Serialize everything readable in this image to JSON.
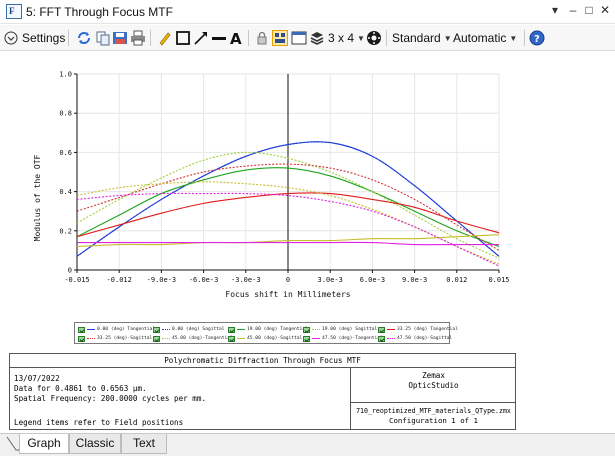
{
  "window": {
    "title": "5: FFT Through Focus MTF",
    "icon_name": "zemax-f-icon",
    "controls": [
      "chevron-down-icon",
      "minimize-icon",
      "maximize-icon",
      "close-icon"
    ]
  },
  "toolbar": {
    "settings_label": "Settings",
    "grid_label": "3 x 4",
    "standard_label": "Standard",
    "automatic_label": "Automatic",
    "icons": [
      "refresh-icon",
      "copy-icon",
      "save-icon",
      "print-icon",
      "pencil-icon",
      "rectangle-icon",
      "line-arrow-icon",
      "line-icon",
      "text-icon",
      "lock-icon",
      "layout-icon",
      "window-icon",
      "layers-icon",
      "settings-circle-icon",
      "help-icon"
    ]
  },
  "chart_data": {
    "type": "line",
    "xlabel": "Focus shift in Millimeters",
    "ylabel": "Modulus of the OTF",
    "xlim": [
      -0.015,
      0.015
    ],
    "ylim": [
      0,
      1.0
    ],
    "x_ticks": [
      "-0.015",
      "-0.012",
      "-9.0e-3",
      "-6.0e-3",
      "-3.0e-3",
      "0",
      "3.0e-3",
      "6.0e-3",
      "9.0e-3",
      "0.012",
      "0.015"
    ],
    "y_ticks": [
      "0",
      "0.2",
      "0.4",
      "0.6",
      "0.8",
      "1.0"
    ],
    "grid": true,
    "x": [
      -0.015,
      -0.012,
      -0.009,
      -0.006,
      -0.003,
      0,
      0.003,
      0.006,
      0.009,
      0.012,
      0.015
    ],
    "series": [
      {
        "name": "0.00 (deg) Tangential",
        "color": "#1f3fd6",
        "dash": false,
        "values": [
          0.07,
          0.22,
          0.36,
          0.48,
          0.58,
          0.64,
          0.65,
          0.58,
          0.43,
          0.25,
          0.07
        ]
      },
      {
        "name": "0.00 (deg) Sagittal",
        "color": "#1f3fd6",
        "dash": true,
        "values": [
          0.07,
          0.22,
          0.36,
          0.48,
          0.58,
          0.64,
          0.65,
          0.58,
          0.43,
          0.25,
          0.07
        ]
      },
      {
        "name": "19.00 (deg) Tangential",
        "color": "#1ea41e",
        "dash": false,
        "values": [
          0.17,
          0.28,
          0.39,
          0.46,
          0.51,
          0.52,
          0.48,
          0.4,
          0.3,
          0.2,
          0.12
        ]
      },
      {
        "name": "19.00 (deg) Sagittal",
        "color": "#9fd13a",
        "dash": true,
        "values": [
          0.24,
          0.36,
          0.47,
          0.56,
          0.6,
          0.57,
          0.5,
          0.4,
          0.28,
          0.16,
          0.06
        ]
      },
      {
        "name": "33.25 (deg) Tangential",
        "color": "#e01b1b",
        "dash": false,
        "values": [
          0.17,
          0.23,
          0.29,
          0.34,
          0.37,
          0.39,
          0.39,
          0.36,
          0.32,
          0.25,
          0.19
        ]
      },
      {
        "name": "33.25 (deg) Sagittal",
        "color": "#d43333",
        "dash": true,
        "values": [
          0.3,
          0.37,
          0.44,
          0.5,
          0.53,
          0.54,
          0.52,
          0.46,
          0.36,
          0.23,
          0.1
        ]
      },
      {
        "name": "45.00 (deg) Tangential",
        "color": "#c8bd2a",
        "dash": true,
        "values": [
          0.38,
          0.42,
          0.44,
          0.45,
          0.44,
          0.42,
          0.38,
          0.31,
          0.22,
          0.12,
          0.03
        ]
      },
      {
        "name": "45.00 (deg) Sagittal",
        "color": "#c8bd2a",
        "dash": false,
        "values": [
          0.12,
          0.13,
          0.13,
          0.14,
          0.14,
          0.15,
          0.15,
          0.16,
          0.16,
          0.17,
          0.18
        ]
      },
      {
        "name": "47.50 (deg) Tangential",
        "color": "#e223e2",
        "dash": false,
        "values": [
          0.14,
          0.14,
          0.14,
          0.14,
          0.14,
          0.14,
          0.14,
          0.14,
          0.13,
          0.13,
          0.13
        ]
      },
      {
        "name": "47.50 (deg) Sagittal",
        "color": "#e223e2",
        "dash": true,
        "values": [
          0.36,
          0.38,
          0.39,
          0.39,
          0.39,
          0.38,
          0.35,
          0.3,
          0.22,
          0.12,
          0.02
        ]
      }
    ],
    "legend_placement": "bottom"
  },
  "legend": [
    {
      "label": "0.00 (deg) Tangential",
      "color": "#1f3fd6",
      "style": "solid"
    },
    {
      "label": "0.00 (deg) Sagittal",
      "color": "#1f3fd6",
      "style": "dotted"
    },
    {
      "label": "19.00 (deg) Tangential",
      "color": "#1ea41e",
      "style": "solid"
    },
    {
      "label": "19.00 (deg) Sagittal",
      "color": "#9fd13a",
      "style": "dotted"
    },
    {
      "label": "33.25 (deg) Tangential",
      "color": "#e01b1b",
      "style": "solid"
    },
    {
      "label": "33.25 (deg)-Sagittal",
      "color": "#d43333",
      "style": "dotted"
    },
    {
      "label": "45.00 (deg)-Tangential",
      "color": "#c8bd2a",
      "style": "dotted"
    },
    {
      "label": "45.00 (deg)-Sagittal",
      "color": "#c8bd2a",
      "style": "solid"
    },
    {
      "label": "47.50 (deg)-Tangential",
      "color": "#e223e2",
      "style": "solid"
    },
    {
      "label": "47.50 (deg)-Sagittal",
      "color": "#e223e2",
      "style": "dotted"
    }
  ],
  "info": {
    "title": "Polychromatic Diffraction Through Focus MTF",
    "date": "13/07/2022",
    "data_range": "Data for 0.4861 to 0.6563 µm.",
    "frequency": "Spatial Frequency: 200.0000 cycles per mm.",
    "note": "Legend items refer to Field positions",
    "company": "Zemax",
    "product": "OpticStudio",
    "file": "710_reoptimized_MTF_materials_QType.zmx",
    "config": "Configuration 1 of 1"
  },
  "tabs": [
    {
      "label": "Graph",
      "active": true
    },
    {
      "label": "Classic",
      "active": false
    },
    {
      "label": "Text",
      "active": false
    }
  ]
}
